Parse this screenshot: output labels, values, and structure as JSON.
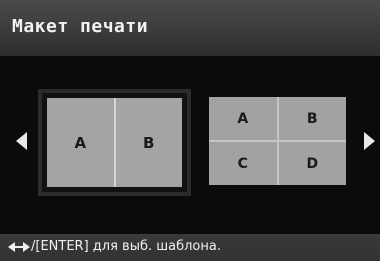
{
  "header": {
    "title": "Макет печати"
  },
  "layouts": [
    {
      "selected": true,
      "cells": [
        "A",
        "B"
      ]
    },
    {
      "selected": false,
      "cells": [
        "A",
        "B",
        "C",
        "D"
      ]
    }
  ],
  "footer": {
    "icon": "left-right-arrows-icon",
    "hint": "/[ENTER] для выб. шаблона."
  },
  "colors": {
    "background": "#0b0b0b",
    "bar": "#3a3a3a",
    "cell": "#a4a4a4",
    "text": "#f0f0f0"
  }
}
